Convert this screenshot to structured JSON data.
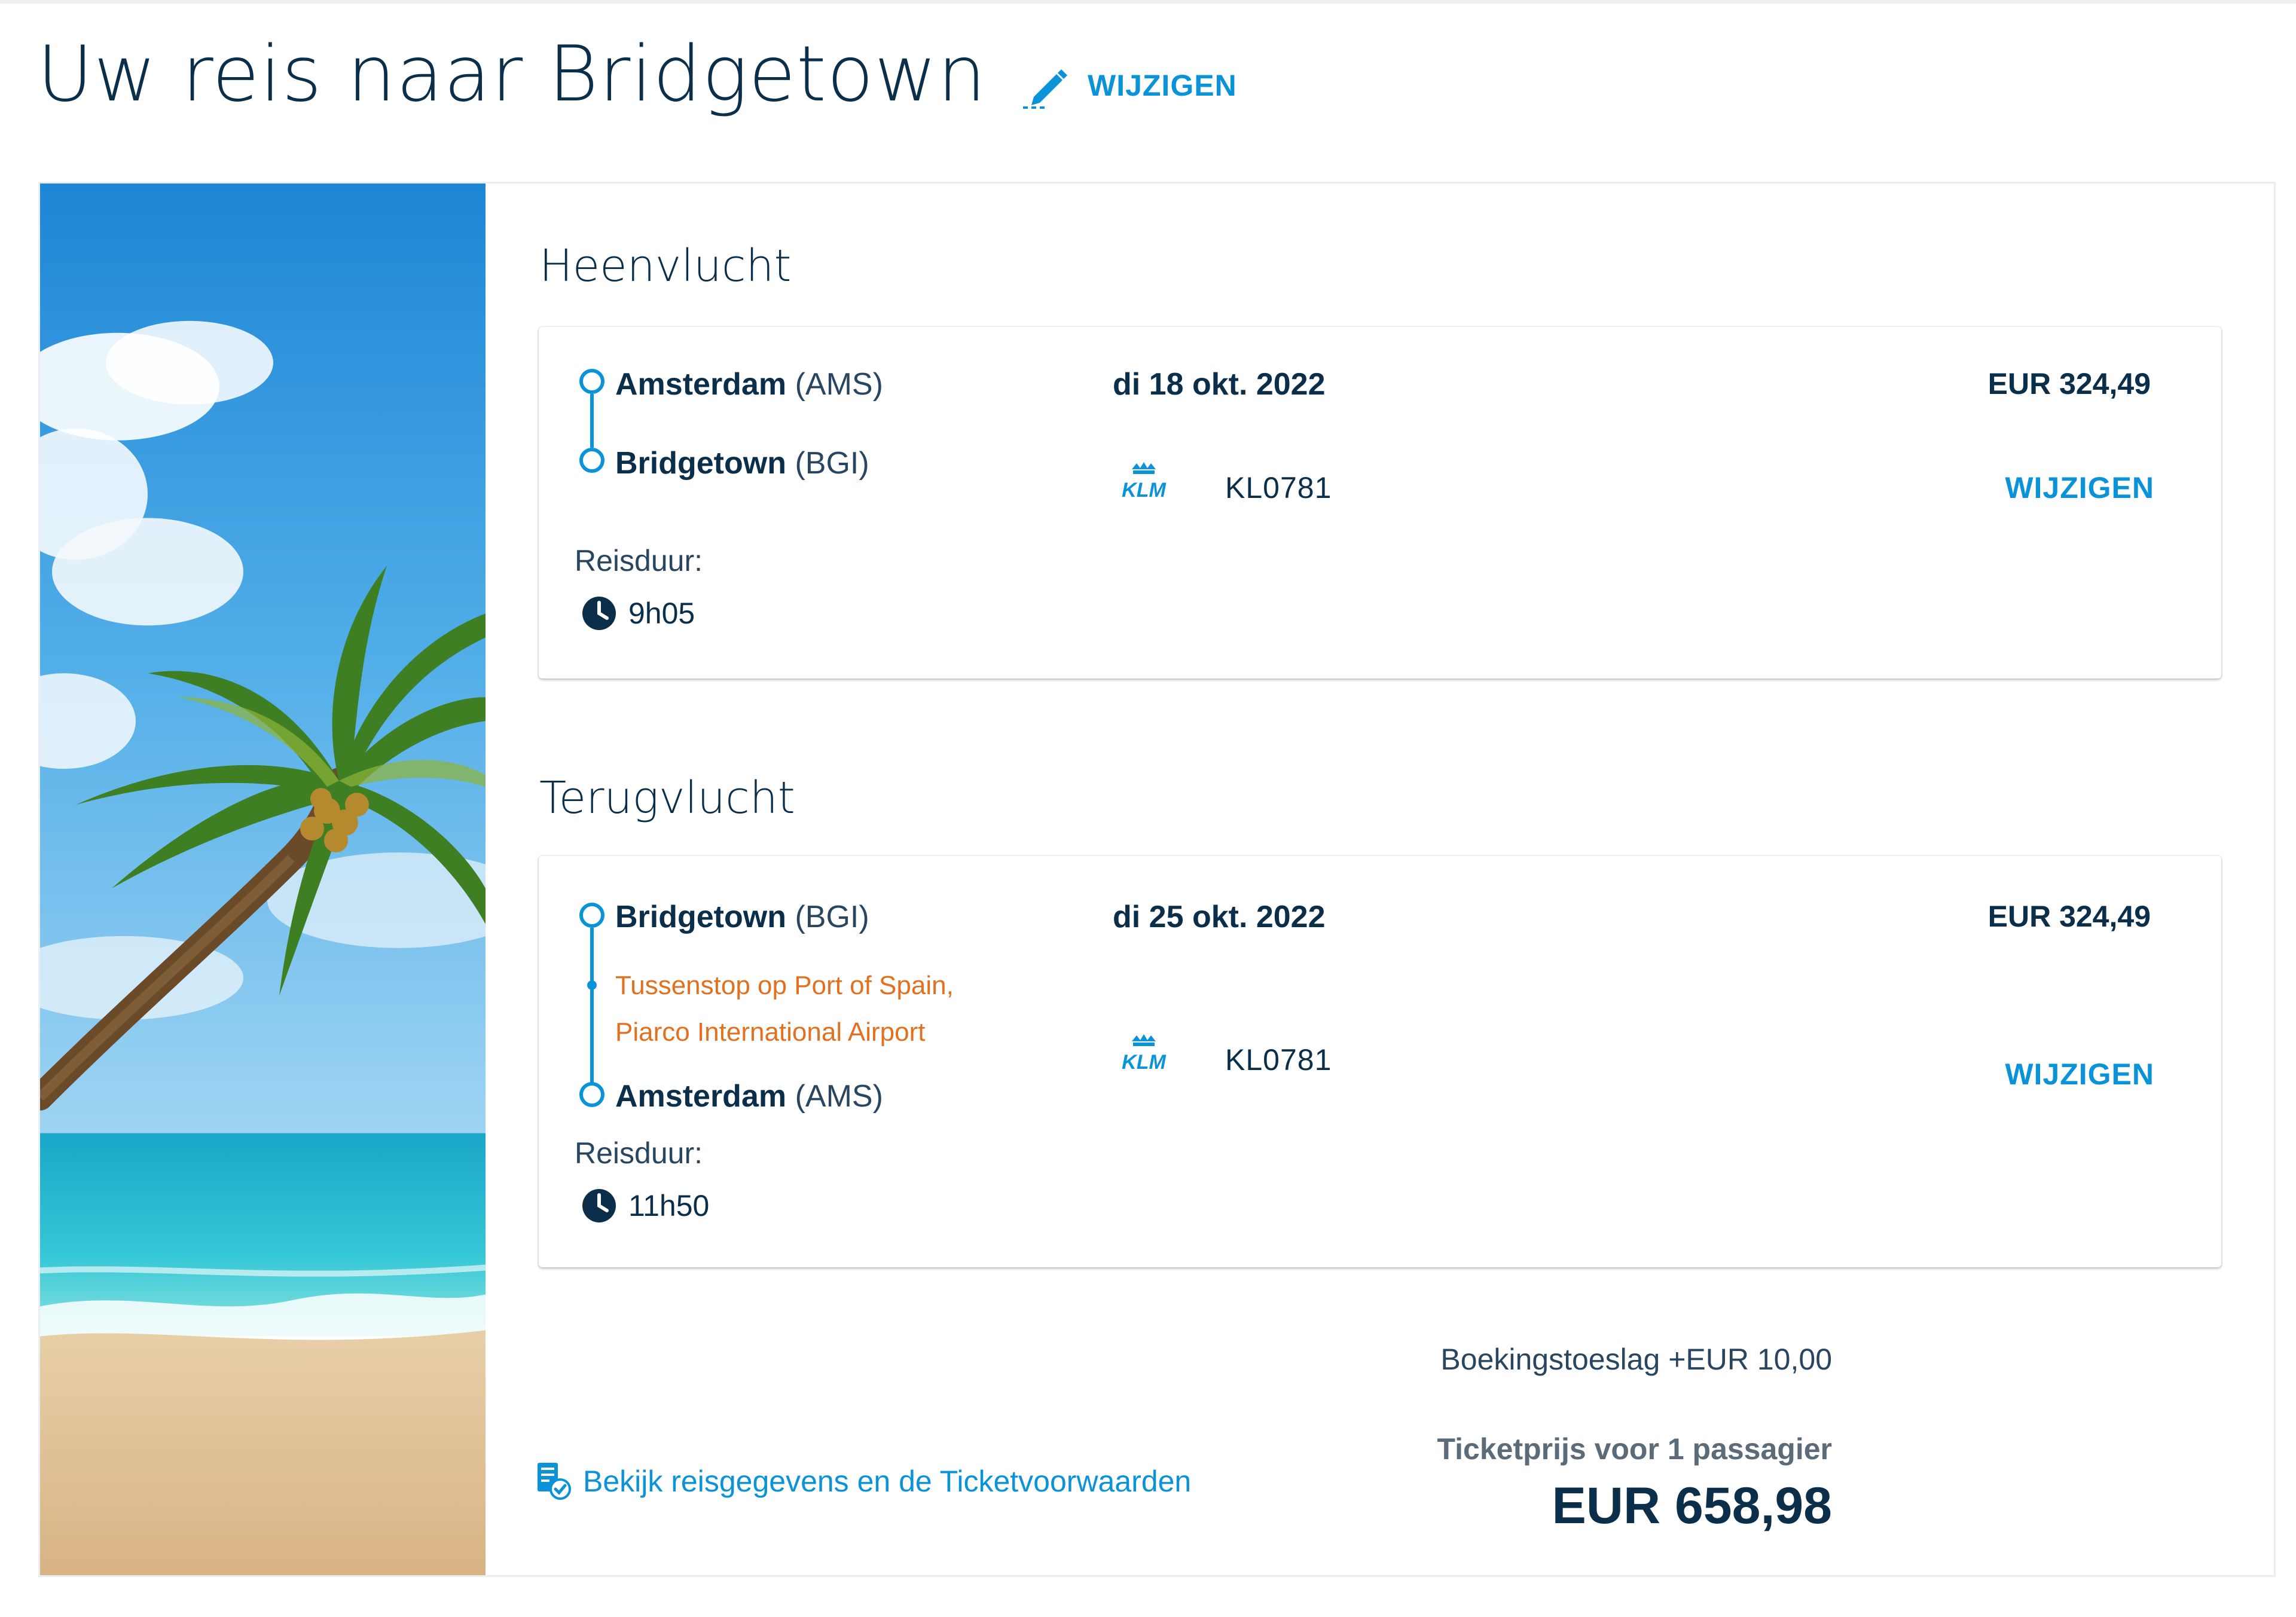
{
  "header": {
    "title": "Uw reis naar Bridgetown",
    "edit_label": "WIJZIGEN"
  },
  "outbound": {
    "section_title": "Heenvlucht",
    "from_city": "Amsterdam",
    "from_code": "(AMS)",
    "to_city": "Bridgetown",
    "to_code": "(BGI)",
    "date": "di 18 okt. 2022",
    "price": "EUR 324,49",
    "airline_logo": "KLM",
    "flight_number": "KL0781",
    "edit_label": "WIJZIGEN",
    "duration_label": "Reisduur:",
    "duration": "9h05"
  },
  "inbound": {
    "section_title": "Terugvlucht",
    "from_city": "Bridgetown",
    "from_code": "(BGI)",
    "stop_line1": "Tussenstop op Port of Spain,",
    "stop_line2": "Piarco International Airport",
    "to_city": "Amsterdam",
    "to_code": "(AMS)",
    "date": "di 25 okt. 2022",
    "price": "EUR 324,49",
    "airline_logo": "KLM",
    "flight_number": "KL0781",
    "edit_label": "WIJZIGEN",
    "duration_label": "Reisduur:",
    "duration": "11h50"
  },
  "summary": {
    "booking_fee": "Boekingstoeslag +EUR 10,00",
    "ticket_label": "Ticketprijs voor 1 passagier",
    "total": "EUR 658,98"
  },
  "footer": {
    "details_link": "Bekijk reisgegevens en de Ticketvoorwaarden"
  },
  "icons": {
    "edit": "pencil-icon",
    "duration": "clock-icon",
    "airline": "klm-logo",
    "details": "document-check-icon"
  },
  "colors": {
    "accent": "#0a93d9",
    "text": "#0b2e4a",
    "stopover": "#e3701f"
  }
}
